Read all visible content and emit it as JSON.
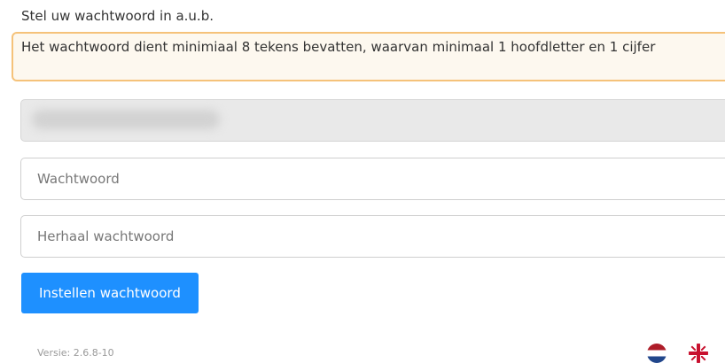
{
  "form": {
    "instruction": "Stel uw wachtwoord in a.u.b.",
    "hint": "Het wachtwoord dient minimiaal 8 tekens bevatten, waarvan minimaal 1 hoofdletter en 1 cijfer",
    "password_placeholder": "Wachtwoord",
    "repeat_placeholder": "Herhaal wachtwoord",
    "submit_label": "Instellen wachtwoord"
  },
  "footer": {
    "version": "Versie: 2.6.8-10",
    "languages": [
      {
        "code": "nl",
        "icon": "netherlands-flag-icon"
      },
      {
        "code": "en",
        "icon": "uk-flag-icon"
      }
    ]
  },
  "colors": {
    "accent": "#1e90ff",
    "hint_border": "#f5c27a",
    "disabled_field": "#e9e9e9"
  }
}
